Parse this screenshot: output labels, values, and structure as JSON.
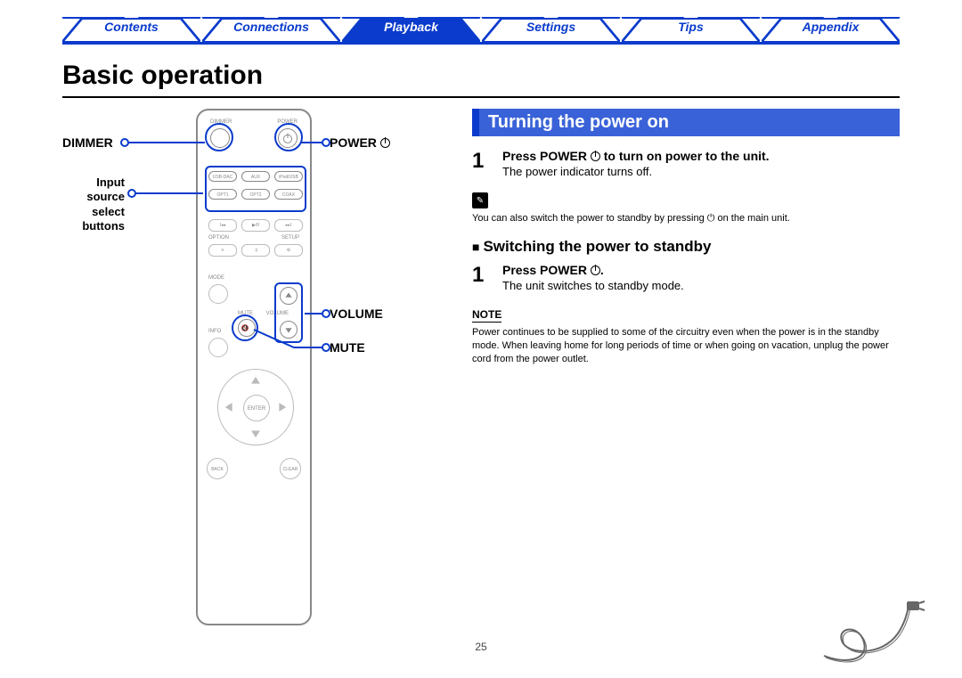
{
  "nav": {
    "tabs": [
      "Contents",
      "Connections",
      "Playback",
      "Settings",
      "Tips",
      "Appendix"
    ],
    "active_index": 2
  },
  "page_title": "Basic operation",
  "left_labels": {
    "dimmer": "DIMMER",
    "power": "POWER",
    "input_source": "Input\nsource\nselect\nbuttons",
    "volume": "VOLUME",
    "mute": "MUTE"
  },
  "remote_text": {
    "dimmer": "DIMMER",
    "power": "POWER",
    "src_row1": [
      "USB-DAC",
      "AUX",
      "iPod/USB"
    ],
    "src_row2": [
      "OPT1",
      "OPT2",
      "COAX"
    ],
    "option": "OPTION",
    "setup": "SETUP",
    "mode": "MODE",
    "mute": "MUTE",
    "volume": "VOLUME",
    "info": "INFO",
    "enter": "ENTER",
    "back": "BACK",
    "clear": "CLEAR"
  },
  "section_title": "Turning the power on",
  "step1": {
    "num": "1",
    "bold_a": "Press POWER ",
    "bold_b": " to turn on power to the unit.",
    "body": "The power indicator turns off."
  },
  "pencil_note": "You can also switch the power to standby by pressing ⏻ on the main unit.",
  "sub_heading": "Switching the power to standby",
  "step2": {
    "num": "1",
    "bold_a": "Press POWER ",
    "bold_b": ".",
    "body": "The unit switches to standby mode."
  },
  "note_label": "NOTE",
  "note_text": "Power continues to be supplied to some of the circuitry even when the power is in the standby mode. When leaving home for long periods of time or when going on vacation, unplug the power cord from the power outlet.",
  "page_number": "25"
}
